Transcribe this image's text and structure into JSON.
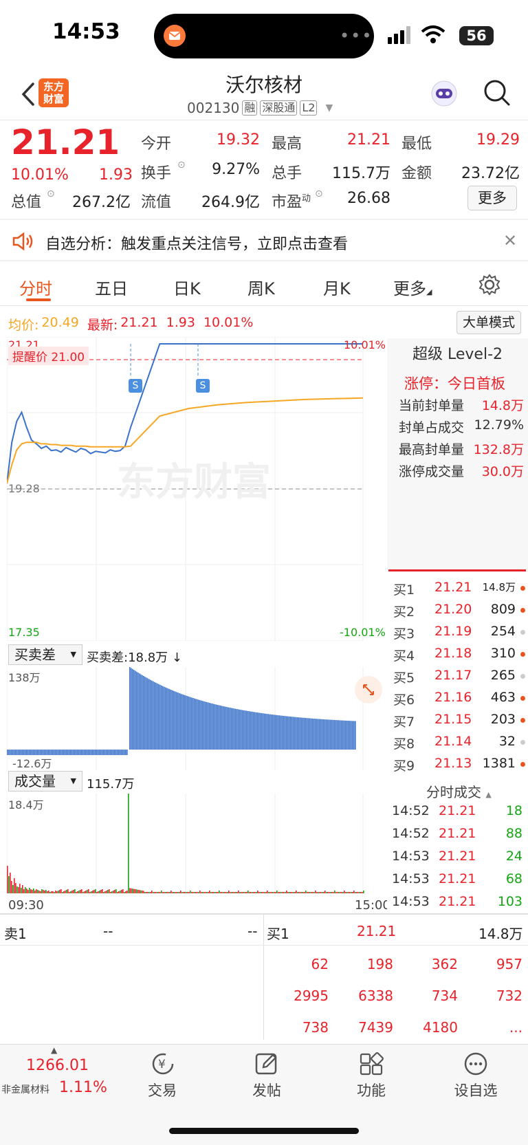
{
  "status_bar": {
    "time": "14:53",
    "battery": "56"
  },
  "header": {
    "logo_line1": "东方",
    "logo_line2": "财富",
    "stock_name": "沃尔核材",
    "stock_code": "002130",
    "tags": [
      "融",
      "深股通",
      "L2"
    ]
  },
  "quote": {
    "price": "21.21",
    "change_pct": "10.01%",
    "change": "1.93",
    "fields": [
      {
        "label": "今开",
        "value": "19.32",
        "color": "#e8222a"
      },
      {
        "label": "最高",
        "value": "21.21",
        "color": "#e8222a"
      },
      {
        "label": "最低",
        "value": "19.29",
        "color": "#e8222a"
      },
      {
        "label": "换手",
        "value": "9.27%",
        "color": "#222222"
      },
      {
        "label": "总手",
        "value": "115.7万",
        "color": "#222222"
      },
      {
        "label": "金额",
        "value": "23.72亿",
        "color": "#222222"
      },
      {
        "label": "总值",
        "value": "267.2亿",
        "color": "#222222"
      },
      {
        "label": "流值",
        "value": "264.9亿",
        "color": "#222222"
      },
      {
        "label": "市盈",
        "label_sup": "动",
        "value": "26.68",
        "color": "#222222"
      }
    ],
    "more_label": "更多"
  },
  "notice": {
    "text": "自选分析：触发重点关注信号，立即点击查看"
  },
  "tabs": [
    "分时",
    "五日",
    "日K",
    "周K",
    "月K",
    "更多"
  ],
  "info_line": {
    "avg_label": "均价:",
    "avg_value": "20.49",
    "latest_label": "最新:",
    "latest_value": "21.21",
    "latest_change": "1.93",
    "latest_pct": "10.01%",
    "big_order_btn": "大单模式"
  },
  "chart_labels": {
    "top_price": "21.21",
    "top_pct": "10.01%",
    "alert_label": "提醒价 21.00",
    "mid_price": "19.28",
    "bottom_price": "17.35",
    "bottom_pct": "-10.01%",
    "watermark": "东方财富",
    "s_marker": "S",
    "bs_selector": "买卖差",
    "bs_value": "买卖差:18.8万 ↓",
    "bs_top": "138万",
    "bs_bottom": "-12.6万",
    "vol_selector": "成交量",
    "vol_value": "115.7万",
    "vol_top": "18.4万",
    "time_start": "09:30",
    "time_end": "15:00"
  },
  "chart_data": {
    "type": "line",
    "x_range": [
      "09:30",
      "15:00"
    ],
    "ylim": [
      17.35,
      21.21
    ],
    "reference": 19.28,
    "alert": 21.0,
    "series": [
      {
        "name": "最新",
        "color": "#3a72c9",
        "values": [
          19.35,
          19.9,
          20.18,
          20.3,
          20.1,
          19.93,
          19.88,
          19.82,
          19.85,
          19.79,
          19.8,
          19.77,
          19.83,
          19.8,
          19.77,
          19.82,
          19.8,
          19.75,
          19.78,
          19.77,
          19.76,
          19.8,
          19.78,
          19.79,
          19.85,
          20.1,
          21.21,
          21.21,
          21.21,
          21.21,
          21.21,
          21.21,
          21.21,
          21.21
        ]
      },
      {
        "name": "均价",
        "color": "#f5a623",
        "values": [
          19.35,
          19.6,
          19.8,
          19.88,
          19.9,
          19.9,
          19.9,
          19.88,
          19.88,
          19.87,
          19.87,
          19.86,
          19.86,
          19.86,
          19.85,
          19.85,
          19.85,
          19.84,
          19.84,
          19.84,
          19.84,
          19.84,
          19.84,
          19.84,
          19.84,
          19.85,
          20.25,
          20.35,
          20.4,
          20.43,
          20.45,
          20.47,
          20.48,
          20.49
        ]
      }
    ]
  },
  "level2": {
    "title": "超级 Level-2",
    "limit_status": "涨停：今日首板",
    "rows": [
      {
        "label": "当前封单量",
        "value": "14.8万",
        "color": "#e8222a"
      },
      {
        "label": "封单占成交",
        "value": "12.79%",
        "color": "#333333"
      },
      {
        "label": "最高封单量",
        "value": "132.8万",
        "color": "#e8222a"
      },
      {
        "label": "涨停成交量",
        "value": "30.0万",
        "color": "#e8222a"
      }
    ]
  },
  "bids": [
    {
      "label": "买1",
      "price": "21.21",
      "vol": "14.8万",
      "dot": "#e8551e"
    },
    {
      "label": "买2",
      "price": "21.20",
      "vol": "809",
      "dot": "#e8551e"
    },
    {
      "label": "买3",
      "price": "21.19",
      "vol": "254",
      "dot": "#cccccc"
    },
    {
      "label": "买4",
      "price": "21.18",
      "vol": "310",
      "dot": "#e8551e"
    },
    {
      "label": "买5",
      "price": "21.17",
      "vol": "265",
      "dot": "#cccccc"
    },
    {
      "label": "买6",
      "price": "21.16",
      "vol": "463",
      "dot": "#e8551e"
    },
    {
      "label": "买7",
      "price": "21.15",
      "vol": "203",
      "dot": "#e8551e"
    },
    {
      "label": "买8",
      "price": "21.14",
      "vol": "32",
      "dot": "#cccccc"
    },
    {
      "label": "买9",
      "price": "21.13",
      "vol": "1381",
      "dot": "#e8551e"
    }
  ],
  "ticks_title": "分时成交",
  "ticks": [
    {
      "time": "14:52",
      "price": "21.21",
      "vol": "18"
    },
    {
      "time": "14:52",
      "price": "21.21",
      "vol": "88"
    },
    {
      "time": "14:53",
      "price": "21.21",
      "vol": "24"
    },
    {
      "time": "14:53",
      "price": "21.21",
      "vol": "68"
    },
    {
      "time": "14:53",
      "price": "21.21",
      "vol": "103"
    }
  ],
  "orderbook": {
    "sell1_label": "卖1",
    "sell1_price": "--",
    "sell1_vol": "--",
    "buy1_label": "买1",
    "buy1_price": "21.21",
    "buy1_vol": "14.8万",
    "queue": [
      [
        "62",
        "198",
        "362",
        "957"
      ],
      [
        "2995",
        "6338",
        "734",
        "732"
      ],
      [
        "738",
        "7439",
        "4180",
        "..."
      ]
    ]
  },
  "bottom_nav": {
    "index_value": "1266.01",
    "index_name": "非金属材料",
    "index_pct": "1.11%",
    "items": [
      "交易",
      "发帖",
      "功能",
      "设自选"
    ]
  },
  "colors": {
    "up": "#e8222a",
    "down": "#14a514",
    "accent": "#e8551e",
    "line": "#3a72c9",
    "avg": "#f5a623"
  }
}
